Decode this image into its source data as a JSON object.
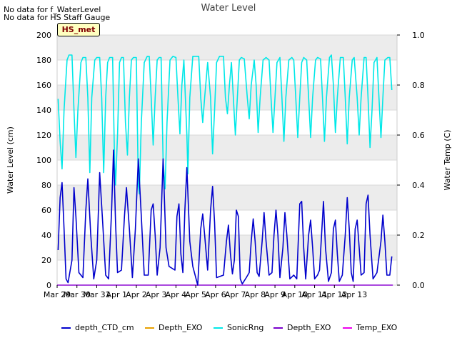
{
  "notes": [
    "No data for f_WaterLevel",
    "No data for HS Staff Gauge"
  ],
  "site_badge": "HS_met",
  "chart_data": {
    "type": "line",
    "title": "Water Level",
    "ylabel": "Water Level (cm)",
    "y2label": "Water Temp (C)",
    "xlim": [
      0,
      15
    ],
    "ylim": [
      0,
      200
    ],
    "y2lim": [
      0.0,
      1.0
    ],
    "x_ticks": [
      0,
      1,
      2,
      3,
      4,
      5,
      6,
      7,
      8,
      9,
      10,
      11,
      12,
      13,
      14,
      15
    ],
    "x_tick_labels": [
      "Mar 29",
      "Mar 30",
      "Mar 31",
      "Apr 1",
      "Apr 2",
      "Apr 3",
      "Apr 4",
      "Apr 5",
      "Apr 6",
      "Apr 7",
      "Apr 8",
      "Apr 9",
      "Apr 10",
      "Apr 11",
      "Apr 12",
      "Apr 13"
    ],
    "y_ticks": [
      0,
      20,
      40,
      60,
      80,
      100,
      120,
      140,
      160,
      180,
      200
    ],
    "y2_ticks": [
      0.0,
      0.2,
      0.4,
      0.6,
      0.8,
      1.0
    ],
    "y2_tick_labels": [
      "0.0",
      "0.2",
      "0.4",
      "0.6",
      "0.8",
      "1.0"
    ],
    "grid": true,
    "legend_position": "bottom",
    "series": [
      {
        "name": "depth_CTD_cm",
        "color": "#0000cc",
        "axis": "left",
        "points": [
          [
            0.05,
            28
          ],
          [
            0.15,
            70
          ],
          [
            0.25,
            82
          ],
          [
            0.35,
            45
          ],
          [
            0.45,
            5
          ],
          [
            0.55,
            2
          ],
          [
            0.75,
            20
          ],
          [
            0.85,
            78
          ],
          [
            0.95,
            55
          ],
          [
            1.1,
            10
          ],
          [
            1.3,
            6
          ],
          [
            1.45,
            60
          ],
          [
            1.55,
            85
          ],
          [
            1.7,
            40
          ],
          [
            1.85,
            5
          ],
          [
            2.0,
            20
          ],
          [
            2.15,
            90
          ],
          [
            2.3,
            50
          ],
          [
            2.45,
            8
          ],
          [
            2.6,
            5
          ],
          [
            2.75,
            60
          ],
          [
            2.85,
            108
          ],
          [
            2.95,
            50
          ],
          [
            3.05,
            10
          ],
          [
            3.25,
            12
          ],
          [
            3.4,
            55
          ],
          [
            3.5,
            78
          ],
          [
            3.65,
            45
          ],
          [
            3.8,
            6
          ],
          [
            3.95,
            45
          ],
          [
            4.1,
            101
          ],
          [
            4.25,
            55
          ],
          [
            4.4,
            8
          ],
          [
            4.6,
            8
          ],
          [
            4.75,
            60
          ],
          [
            4.85,
            65
          ],
          [
            4.95,
            40
          ],
          [
            5.05,
            8
          ],
          [
            5.2,
            30
          ],
          [
            5.35,
            101
          ],
          [
            5.5,
            30
          ],
          [
            5.65,
            15
          ],
          [
            5.95,
            12
          ],
          [
            6.05,
            55
          ],
          [
            6.15,
            65
          ],
          [
            6.25,
            25
          ],
          [
            6.35,
            10
          ],
          [
            6.45,
            60
          ],
          [
            6.55,
            94
          ],
          [
            6.7,
            35
          ],
          [
            6.85,
            15
          ],
          [
            7.1,
            0
          ],
          [
            7.25,
            45
          ],
          [
            7.35,
            57
          ],
          [
            7.45,
            40
          ],
          [
            7.6,
            12
          ],
          [
            7.75,
            60
          ],
          [
            7.85,
            79
          ],
          [
            7.95,
            50
          ],
          [
            8.05,
            6
          ],
          [
            8.4,
            8
          ],
          [
            8.55,
            35
          ],
          [
            8.65,
            48
          ],
          [
            8.75,
            25
          ],
          [
            8.85,
            9
          ],
          [
            8.95,
            20
          ],
          [
            9.05,
            60
          ],
          [
            9.15,
            55
          ],
          [
            9.25,
            5
          ],
          [
            9.35,
            1
          ],
          [
            9.55,
            6
          ],
          [
            9.7,
            10
          ],
          [
            9.8,
            35
          ],
          [
            9.9,
            53
          ],
          [
            10.0,
            35
          ],
          [
            10.1,
            10
          ],
          [
            10.2,
            7
          ],
          [
            10.35,
            35
          ],
          [
            10.45,
            58
          ],
          [
            10.55,
            35
          ],
          [
            10.7,
            8
          ],
          [
            10.85,
            10
          ],
          [
            10.95,
            40
          ],
          [
            11.05,
            60
          ],
          [
            11.15,
            40
          ],
          [
            11.25,
            6
          ],
          [
            11.4,
            30
          ],
          [
            11.5,
            58
          ],
          [
            11.6,
            40
          ],
          [
            11.75,
            5
          ],
          [
            11.95,
            8
          ],
          [
            12.1,
            5
          ],
          [
            12.25,
            65
          ],
          [
            12.35,
            67
          ],
          [
            12.45,
            30
          ],
          [
            12.55,
            5
          ],
          [
            12.7,
            40
          ],
          [
            12.8,
            52
          ],
          [
            12.9,
            30
          ],
          [
            13.0,
            5
          ],
          [
            13.15,
            8
          ],
          [
            13.25,
            12
          ],
          [
            13.35,
            40
          ],
          [
            13.45,
            67
          ],
          [
            13.55,
            30
          ],
          [
            13.7,
            3
          ],
          [
            13.85,
            10
          ],
          [
            13.95,
            45
          ],
          [
            14.05,
            52
          ],
          [
            14.15,
            25
          ],
          [
            14.25,
            3
          ],
          [
            14.4,
            8
          ],
          [
            14.55,
            40
          ],
          [
            14.65,
            70
          ],
          [
            14.75,
            45
          ],
          [
            14.85,
            10
          ],
          [
            14.95,
            3
          ],
          [
            15.05,
            45
          ],
          [
            15.15,
            52
          ],
          [
            15.25,
            30
          ],
          [
            15.35,
            8
          ],
          [
            15.5,
            10
          ],
          [
            15.6,
            65
          ],
          [
            15.7,
            72
          ],
          [
            15.8,
            40
          ],
          [
            15.95,
            5
          ],
          [
            16.15,
            10
          ],
          [
            16.35,
            35
          ],
          [
            16.45,
            56
          ],
          [
            16.55,
            35
          ],
          [
            16.65,
            8
          ],
          [
            16.8,
            8
          ],
          [
            16.9,
            23
          ]
        ]
      },
      {
        "name": "Depth_EXO",
        "color": "#e8a000",
        "axis": "left",
        "points": []
      },
      {
        "name": "SonicRng",
        "color": "#00e8e8",
        "axis": "left",
        "points": [
          [
            0.05,
            149
          ],
          [
            0.15,
            115
          ],
          [
            0.25,
            93
          ],
          [
            0.35,
            140
          ],
          [
            0.5,
            180
          ],
          [
            0.6,
            184
          ],
          [
            0.75,
            184
          ],
          [
            0.85,
            140
          ],
          [
            0.95,
            102
          ],
          [
            1.05,
            140
          ],
          [
            1.2,
            178
          ],
          [
            1.3,
            182
          ],
          [
            1.45,
            182
          ],
          [
            1.55,
            150
          ],
          [
            1.65,
            90
          ],
          [
            1.75,
            150
          ],
          [
            1.9,
            180
          ],
          [
            2.0,
            182
          ],
          [
            2.15,
            182
          ],
          [
            2.25,
            150
          ],
          [
            2.35,
            90
          ],
          [
            2.45,
            150
          ],
          [
            2.55,
            178
          ],
          [
            2.65,
            182
          ],
          [
            2.8,
            182
          ],
          [
            2.9,
            100
          ],
          [
            2.95,
            80
          ],
          [
            3.05,
            120
          ],
          [
            3.15,
            178
          ],
          [
            3.25,
            182
          ],
          [
            3.35,
            182
          ],
          [
            3.45,
            130
          ],
          [
            3.55,
            104
          ],
          [
            3.65,
            150
          ],
          [
            3.75,
            180
          ],
          [
            3.85,
            182
          ],
          [
            4.0,
            182
          ],
          [
            4.1,
            80
          ],
          [
            4.15,
            73
          ],
          [
            4.25,
            130
          ],
          [
            4.4,
            178
          ],
          [
            4.55,
            183
          ],
          [
            4.65,
            183
          ],
          [
            4.75,
            150
          ],
          [
            4.85,
            112
          ],
          [
            4.95,
            150
          ],
          [
            5.05,
            180
          ],
          [
            5.15,
            182
          ],
          [
            5.25,
            182
          ],
          [
            5.35,
            100
          ],
          [
            5.45,
            77
          ],
          [
            5.55,
            130
          ],
          [
            5.7,
            180
          ],
          [
            5.85,
            183
          ],
          [
            6.0,
            182
          ],
          [
            6.1,
            150
          ],
          [
            6.2,
            121
          ],
          [
            6.3,
            160
          ],
          [
            6.4,
            180
          ],
          [
            6.55,
            120
          ],
          [
            6.6,
            89
          ],
          [
            6.7,
            150
          ],
          [
            6.85,
            183
          ],
          [
            7.0,
            183
          ],
          [
            7.15,
            183
          ],
          [
            7.25,
            150
          ],
          [
            7.35,
            130
          ],
          [
            7.45,
            150
          ],
          [
            7.6,
            178
          ],
          [
            7.75,
            150
          ],
          [
            7.85,
            105
          ],
          [
            7.95,
            140
          ],
          [
            8.05,
            178
          ],
          [
            8.2,
            183
          ],
          [
            8.4,
            183
          ],
          [
            8.5,
            150
          ],
          [
            8.6,
            137
          ],
          [
            8.7,
            160
          ],
          [
            8.8,
            178
          ],
          [
            8.9,
            150
          ],
          [
            9.0,
            120
          ],
          [
            9.1,
            150
          ],
          [
            9.2,
            180
          ],
          [
            9.3,
            182
          ],
          [
            9.45,
            181
          ],
          [
            9.6,
            150
          ],
          [
            9.7,
            133
          ],
          [
            9.8,
            160
          ],
          [
            9.95,
            180
          ],
          [
            10.05,
            160
          ],
          [
            10.15,
            122
          ],
          [
            10.25,
            150
          ],
          [
            10.4,
            180
          ],
          [
            10.55,
            182
          ],
          [
            10.7,
            180
          ],
          [
            10.8,
            150
          ],
          [
            10.9,
            122
          ],
          [
            11.0,
            150
          ],
          [
            11.1,
            178
          ],
          [
            11.25,
            182
          ],
          [
            11.35,
            150
          ],
          [
            11.45,
            115
          ],
          [
            11.55,
            150
          ],
          [
            11.7,
            180
          ],
          [
            11.85,
            182
          ],
          [
            11.95,
            180
          ],
          [
            12.05,
            150
          ],
          [
            12.15,
            118
          ],
          [
            12.25,
            150
          ],
          [
            12.35,
            178
          ],
          [
            12.45,
            182
          ],
          [
            12.6,
            180
          ],
          [
            12.7,
            150
          ],
          [
            12.8,
            118
          ],
          [
            12.9,
            150
          ],
          [
            13.05,
            180
          ],
          [
            13.15,
            182
          ],
          [
            13.3,
            181
          ],
          [
            13.4,
            150
          ],
          [
            13.5,
            115
          ],
          [
            13.6,
            150
          ],
          [
            13.75,
            182
          ],
          [
            13.85,
            184
          ],
          [
            13.95,
            160
          ],
          [
            14.05,
            122
          ],
          [
            14.15,
            150
          ],
          [
            14.3,
            182
          ],
          [
            14.45,
            182
          ],
          [
            14.55,
            150
          ],
          [
            14.65,
            113
          ],
          [
            14.75,
            150
          ],
          [
            14.9,
            180
          ],
          [
            15.0,
            182
          ],
          [
            15.15,
            150
          ],
          [
            15.25,
            120
          ],
          [
            15.35,
            150
          ],
          [
            15.5,
            182
          ],
          [
            15.6,
            182
          ],
          [
            15.7,
            150
          ],
          [
            15.8,
            110
          ],
          [
            15.9,
            140
          ],
          [
            16.0,
            178
          ],
          [
            16.15,
            182
          ],
          [
            16.25,
            150
          ],
          [
            16.35,
            118
          ],
          [
            16.45,
            150
          ],
          [
            16.55,
            180
          ],
          [
            16.7,
            182
          ],
          [
            16.8,
            182
          ],
          [
            16.9,
            156
          ]
        ]
      },
      {
        "name": "Depth_EXO",
        "color": "#7a00cc",
        "axis": "left",
        "points": [
          [
            0.0,
            0
          ],
          [
            16.95,
            0
          ]
        ]
      },
      {
        "name": "Temp_EXO",
        "color": "#ee00ee",
        "axis": "right",
        "points": [
          [
            0.0,
            0
          ],
          [
            16.95,
            0
          ]
        ]
      }
    ]
  }
}
